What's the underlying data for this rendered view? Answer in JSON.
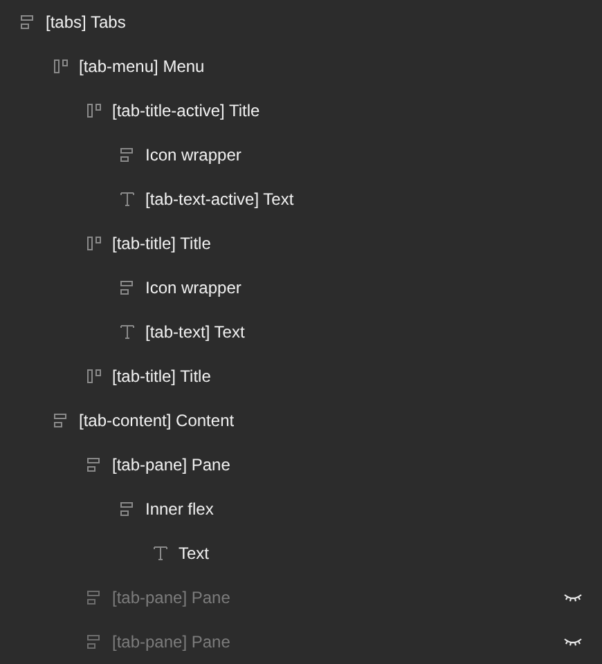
{
  "layers": [
    {
      "name": "[tabs] Tabs",
      "kind": "vertical-stack",
      "hidden": false,
      "children": [
        {
          "name": "[tab-menu] Menu",
          "kind": "horizontal-stack",
          "hidden": false,
          "children": [
            {
              "name": "[tab-title-active] Title",
              "kind": "horizontal-stack",
              "hidden": false,
              "children": [
                {
                  "name": "Icon wrapper",
                  "kind": "vertical-stack",
                  "hidden": false
                },
                {
                  "name": "[tab-text-active] Text",
                  "kind": "text",
                  "hidden": false
                }
              ]
            },
            {
              "name": "[tab-title] Title",
              "kind": "horizontal-stack",
              "hidden": false,
              "children": [
                {
                  "name": "Icon wrapper",
                  "kind": "vertical-stack",
                  "hidden": false
                },
                {
                  "name": "[tab-text] Text",
                  "kind": "text",
                  "hidden": false
                }
              ]
            },
            {
              "name": "[tab-title] Title",
              "kind": "horizontal-stack",
              "hidden": false
            }
          ]
        },
        {
          "name": "[tab-content] Content",
          "kind": "vertical-stack",
          "hidden": false,
          "children": [
            {
              "name": "[tab-pane] Pane",
              "kind": "vertical-stack",
              "hidden": false,
              "children": [
                {
                  "name": "Inner flex",
                  "kind": "vertical-stack",
                  "hidden": false,
                  "children": [
                    {
                      "name": "Text",
                      "kind": "text",
                      "hidden": false
                    }
                  ]
                }
              ]
            },
            {
              "name": "[tab-pane] Pane",
              "kind": "vertical-stack",
              "hidden": true
            },
            {
              "name": "[tab-pane] Pane",
              "kind": "vertical-stack",
              "hidden": true
            }
          ]
        }
      ]
    }
  ]
}
